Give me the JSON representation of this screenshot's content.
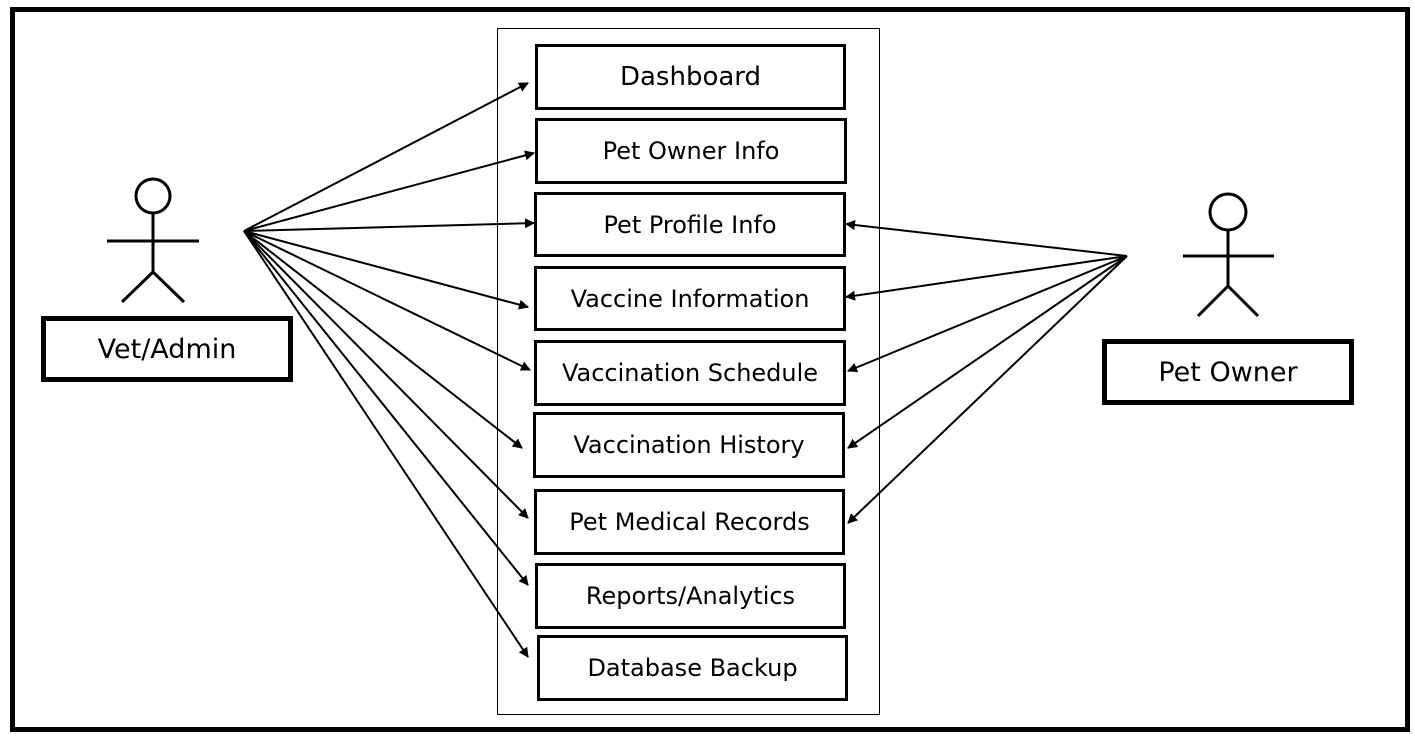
{
  "diagram": {
    "type": "use-case",
    "actors": [
      {
        "id": "vet_admin",
        "label": "Vet/Admin"
      },
      {
        "id": "pet_owner",
        "label": "Pet Owner"
      }
    ],
    "use_cases": [
      {
        "label": "Dashboard"
      },
      {
        "label": "Pet Owner Info"
      },
      {
        "label": "Pet Profile Info"
      },
      {
        "label": "Vaccine Information"
      },
      {
        "label": "Vaccination Schedule"
      },
      {
        "label": "Vaccination History"
      },
      {
        "label": "Pet Medical Records"
      },
      {
        "label": "Reports/Analytics"
      },
      {
        "label": "Database Backup"
      }
    ],
    "associations": {
      "vet_admin": [
        0,
        1,
        2,
        3,
        4,
        5,
        6,
        7,
        8
      ],
      "pet_owner": [
        2,
        3,
        4,
        5,
        6
      ]
    }
  }
}
